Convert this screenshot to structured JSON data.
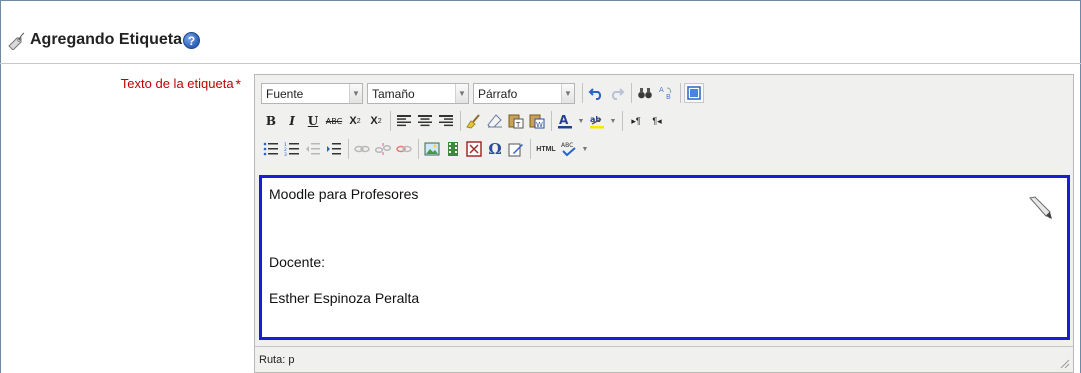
{
  "header": {
    "title": "Agregando Etiqueta",
    "help_glyph": "?"
  },
  "field": {
    "label": "Texto de la etiqueta",
    "required_mark": "*"
  },
  "toolbar": {
    "font_select": "Fuente",
    "size_select": "Tamaño",
    "format_select": "Párrafo",
    "bold": "B",
    "italic": "I",
    "underline": "U",
    "strike": "ABC",
    "subscript": "X",
    "superscript": "X",
    "ltr": "▸¶",
    "rtl": "¶◂",
    "omega": "Ω",
    "html": "HTML"
  },
  "content": {
    "lines": [
      "Moodle para Profesores",
      "Docente:",
      "Esther Espinoza Peralta"
    ]
  },
  "statusbar": {
    "path": "Ruta: p"
  },
  "colors": {
    "required": "#c00000",
    "focus_border": "#1c1cd6",
    "editor_bg": "#f0f0ee"
  }
}
